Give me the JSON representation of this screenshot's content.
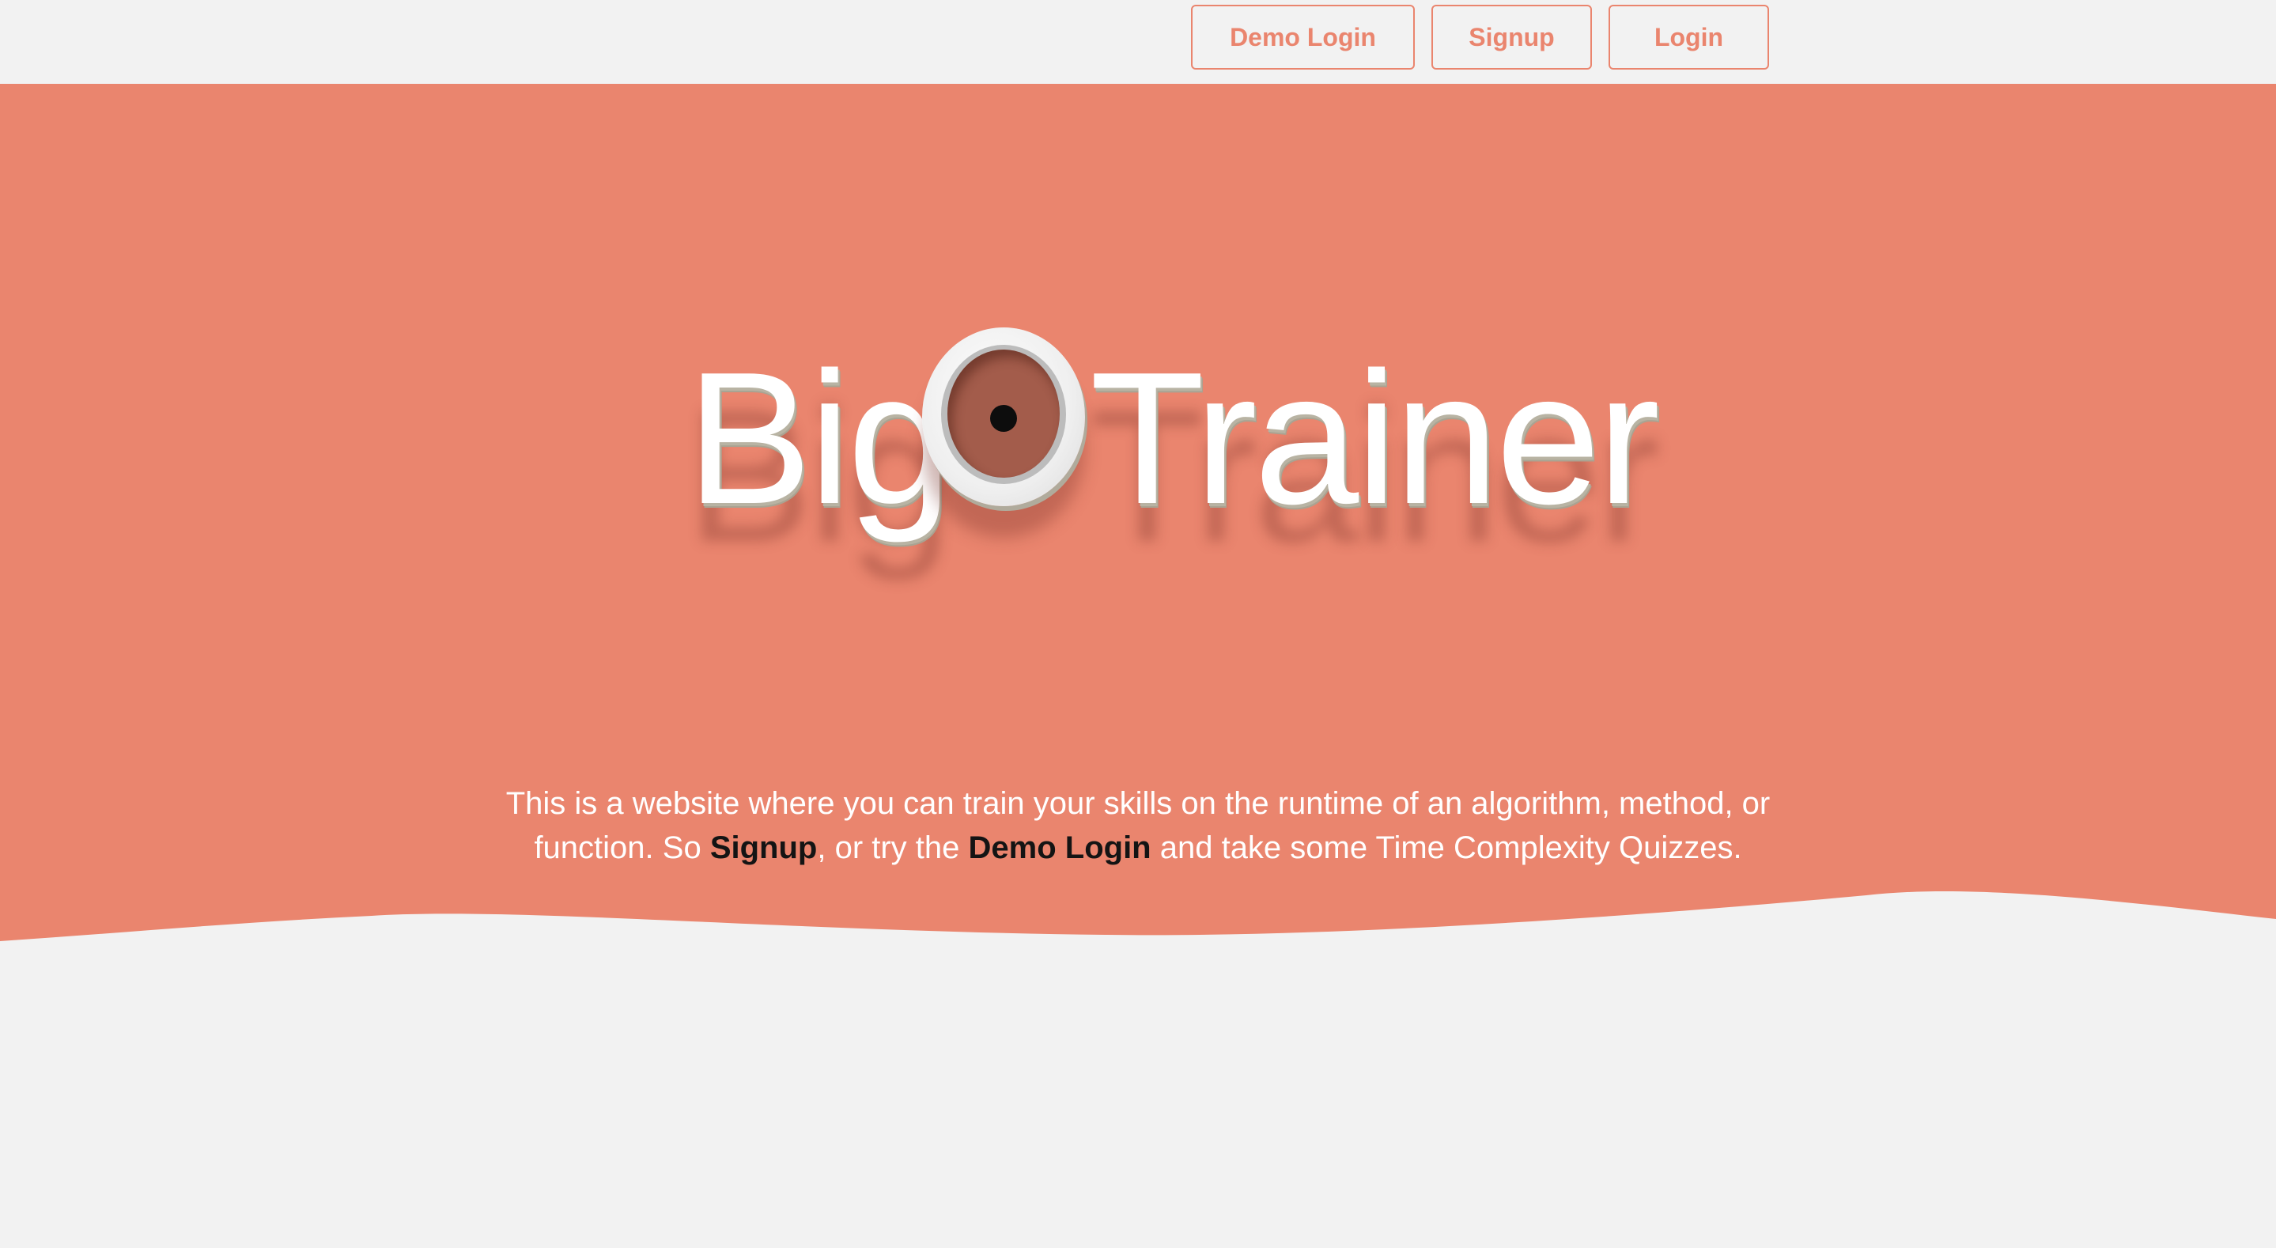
{
  "nav": {
    "demo_login_label": "Demo Login",
    "signup_label": "Signup",
    "login_label": "Login"
  },
  "hero": {
    "logo": {
      "word_before": "Big",
      "letter_o": "O",
      "word_after": "Trainer"
    },
    "tagline": {
      "part1": "This is a website where you can train your skills on the runtime of an algorithm, method, or function. So ",
      "signup_link": "Signup",
      "part2": ", or try the ",
      "demo_link": "Demo Login",
      "part3": " and take some Time Complexity Quizzes."
    }
  },
  "colors": {
    "accent": "#ea856e",
    "background": "#f2f2f2",
    "logo_text": "#ffffff",
    "link_text": "#141414"
  }
}
